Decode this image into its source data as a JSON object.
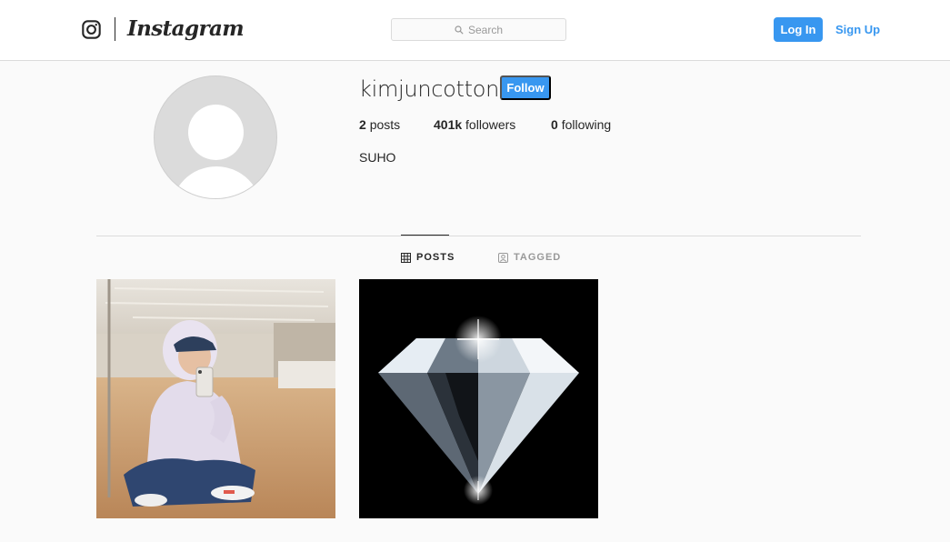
{
  "nav": {
    "brand": "Instagram",
    "search_placeholder": "Search",
    "login_label": "Log In",
    "signup_label": "Sign Up"
  },
  "profile": {
    "username": "kimjuncotton",
    "follow_label": "Follow",
    "stats": {
      "posts_count": "2",
      "posts_label": "posts",
      "followers_count": "401k",
      "followers_label": "followers",
      "following_count": "0",
      "following_label": "following"
    },
    "bio": "SUHO"
  },
  "tabs": [
    {
      "label": "POSTS",
      "active": true,
      "icon": "grid-icon"
    },
    {
      "label": "TAGGED",
      "active": false,
      "icon": "tagged-icon"
    }
  ],
  "colors": {
    "accent": "#3897f0",
    "background": "#fafafa",
    "border": "#dbdbdb",
    "text": "#262626",
    "muted": "#999999"
  }
}
